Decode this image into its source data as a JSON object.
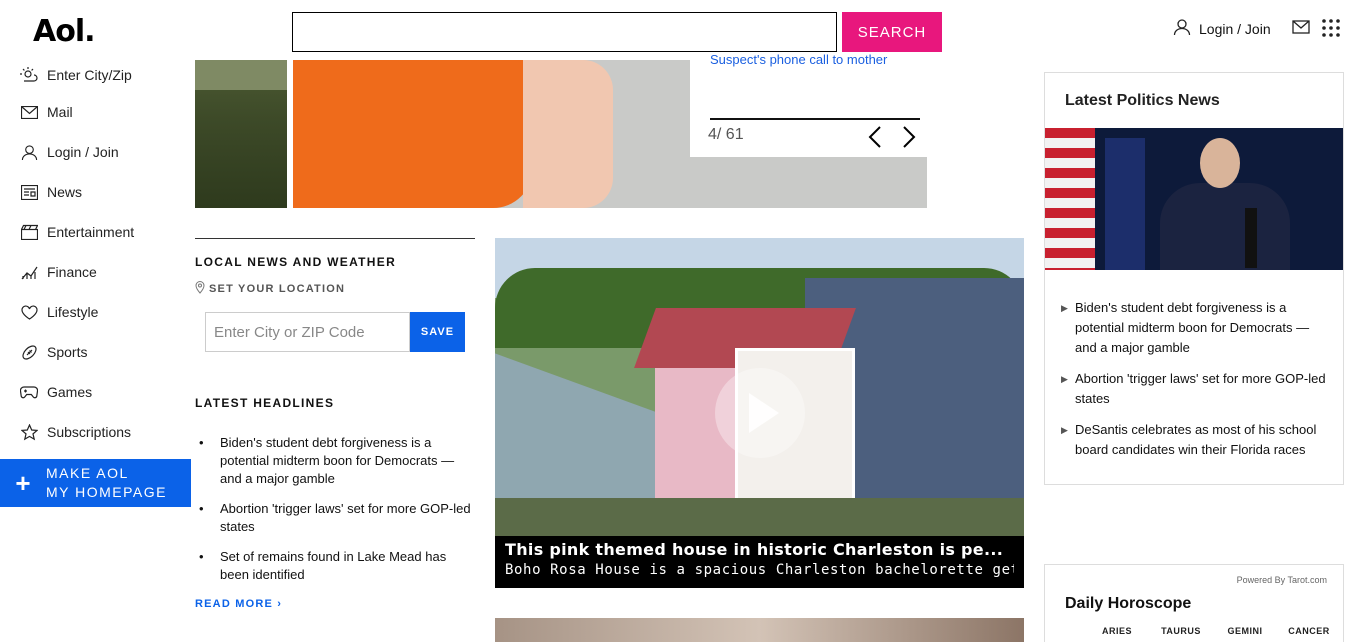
{
  "header": {
    "logo": "Aol.",
    "search_value": "",
    "search_button": "SEARCH",
    "login_label": "Login / Join"
  },
  "sidebar": {
    "items": [
      {
        "label": "Enter City/Zip",
        "icon": "weather-icon"
      },
      {
        "label": "Mail",
        "icon": "mail-icon"
      },
      {
        "label": "Login / Join",
        "icon": "user-icon"
      },
      {
        "label": "News",
        "icon": "news-icon"
      },
      {
        "label": "Entertainment",
        "icon": "clapper-icon"
      },
      {
        "label": "Finance",
        "icon": "chart-icon"
      },
      {
        "label": "Lifestyle",
        "icon": "heart-icon"
      },
      {
        "label": "Sports",
        "icon": "football-icon"
      },
      {
        "label": "Games",
        "icon": "gamepad-icon"
      },
      {
        "label": "Subscriptions",
        "icon": "star-icon"
      }
    ],
    "make_home_line1": "MAKE AOL",
    "make_home_line2": "MY HOMEPAGE"
  },
  "slideshow": {
    "caption_link": "Suspect's phone call to mother",
    "counter": "4/ 61"
  },
  "local_news": {
    "title": "LOCAL NEWS AND WEATHER",
    "set_location": "SET YOUR LOCATION",
    "zip_placeholder": "Enter City or ZIP Code",
    "save_button": "SAVE"
  },
  "latest_headlines": {
    "title": "LATEST HEADLINES",
    "items": [
      "Biden's student debt forgiveness is a potential midterm boon for Democrats — and a major gamble",
      "Abortion 'trigger laws' set for more GOP-led states",
      "Set of remains found in Lake Mead has been identified"
    ],
    "read_more": "READ MORE ›"
  },
  "video": {
    "title": "This pink themed house in historic Charleston is pe...",
    "subtitle": "Boho Rosa House is a spacious Charleston bachelorette geta..."
  },
  "politics": {
    "title": "Latest Politics News",
    "items": [
      "Biden's student debt forgiveness is a potential midterm boon for Democrats — and a major gamble",
      "Abortion 'trigger laws' set for more GOP-led states",
      "DeSantis celebrates as most of his school board candidates win their Florida races"
    ]
  },
  "horoscope": {
    "powered_by": "Powered By Tarot.com",
    "title": "Daily Horoscope",
    "signs": [
      "ARIES",
      "TAURUS",
      "GEMINI",
      "CANCER"
    ]
  },
  "colors": {
    "search_button": "#e8177d",
    "accent_blue": "#0b62e8",
    "link_blue": "#1a5fe0"
  }
}
